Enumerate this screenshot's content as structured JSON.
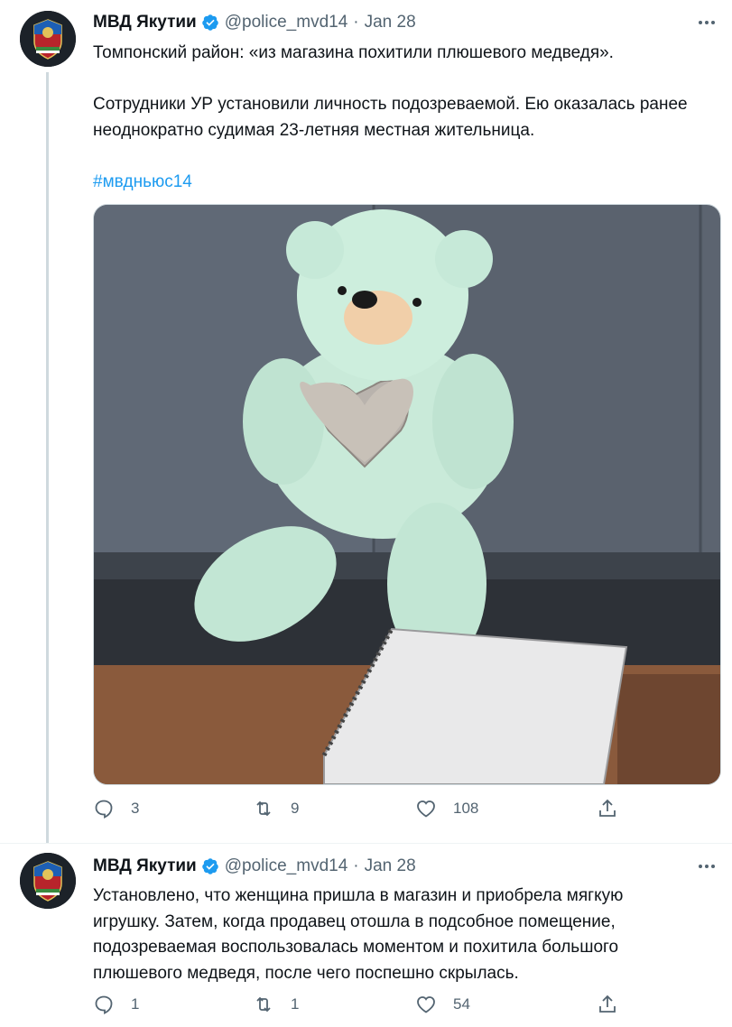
{
  "tweets": [
    {
      "author_name": "МВД Якутии",
      "handle": "@police_mvd14",
      "separator": "·",
      "date": "Jan 28",
      "paragraphs": [
        "Томпонский район: «из магазина похитили плюшевого медведя».",
        "Сотрудники УР установили личность подозреваемой. Ею оказалась ранее неоднократно судимая 23-летняя местная жительница."
      ],
      "hashtag": "#мвдньюс14",
      "image_alt": "teddy-bear-photo",
      "stats": {
        "replies": "3",
        "retweets": "9",
        "likes": "108"
      }
    },
    {
      "author_name": "МВД Якутии",
      "handle": "@police_mvd14",
      "separator": "·",
      "date": "Jan 28",
      "paragraphs": [
        "Установлено, что женщина пришла в магазин и приобрела мягкую игрушку. Затем, когда продавец отошла в подсобное помещение, подозреваемая воспользовалась моментом и похитила большого плюшевого медведя, после чего поспешно скрылась."
      ],
      "stats": {
        "replies": "1",
        "retweets": "1",
        "likes": "54"
      }
    }
  ],
  "icons": {
    "verified": "verified-badge-icon",
    "reply": "reply-icon",
    "retweet": "retweet-icon",
    "like": "heart-icon",
    "share": "share-icon",
    "more": "more-icon"
  },
  "colors": {
    "accent": "#1d9bf0",
    "text": "#0f1419",
    "secondary": "#536471"
  }
}
